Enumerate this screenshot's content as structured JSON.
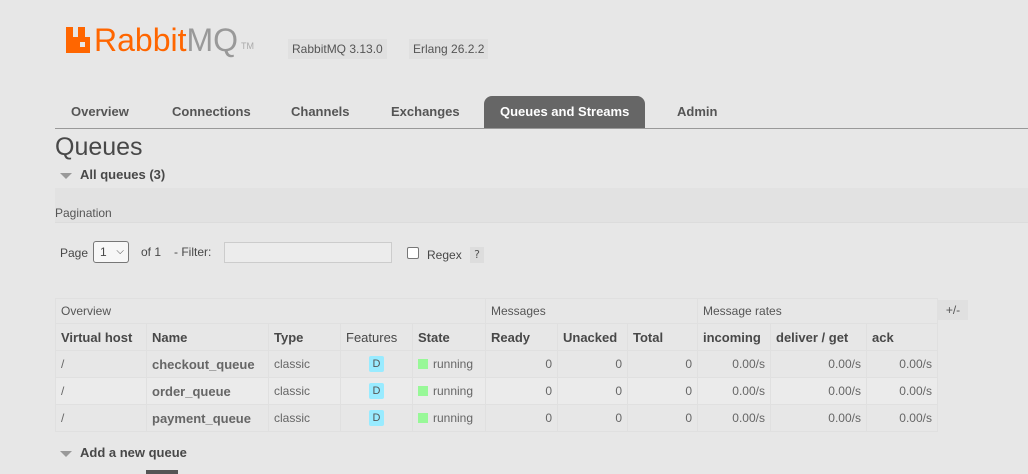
{
  "header": {
    "logo_rabbit": "Rabbit",
    "logo_mq": "MQ",
    "logo_tm": "TM",
    "version": "RabbitMQ 3.13.0",
    "erlang": "Erlang 26.2.2"
  },
  "tabs": [
    {
      "label": "Overview"
    },
    {
      "label": "Connections"
    },
    {
      "label": "Channels"
    },
    {
      "label": "Exchanges"
    },
    {
      "label": "Queues and Streams"
    },
    {
      "label": "Admin"
    }
  ],
  "active_tab": "Queues and Streams",
  "page_title": "Queues",
  "all_queues_label": "All queues (3)",
  "pagination": {
    "section_label": "Pagination",
    "page_label": "Page",
    "page_value": "1",
    "of_label": "of 1",
    "filter_label": "- Filter:",
    "filter_value": "",
    "regex_label": "Regex",
    "help_label": "?"
  },
  "table": {
    "groups": [
      "Overview",
      "Messages",
      "Message rates"
    ],
    "columns": [
      "Virtual host",
      "Name",
      "Type",
      "Features",
      "State",
      "Ready",
      "Unacked",
      "Total",
      "incoming",
      "deliver / get",
      "ack"
    ],
    "rows": [
      {
        "vhost": "/",
        "name": "checkout_queue",
        "type": "classic",
        "feature": "D",
        "state": "running",
        "ready": "0",
        "unacked": "0",
        "total": "0",
        "incoming": "0.00/s",
        "deliver": "0.00/s",
        "ack": "0.00/s"
      },
      {
        "vhost": "/",
        "name": "order_queue",
        "type": "classic",
        "feature": "D",
        "state": "running",
        "ready": "0",
        "unacked": "0",
        "total": "0",
        "incoming": "0.00/s",
        "deliver": "0.00/s",
        "ack": "0.00/s"
      },
      {
        "vhost": "/",
        "name": "payment_queue",
        "type": "classic",
        "feature": "D",
        "state": "running",
        "ready": "0",
        "unacked": "0",
        "total": "0",
        "incoming": "0.00/s",
        "deliver": "0.00/s",
        "ack": "0.00/s"
      }
    ],
    "plus_minus": "+/-"
  },
  "add_queue_label": "Add a new queue",
  "colors": {
    "brand": "#ff6600",
    "running": "#98f898",
    "durable_badge": "#99ebff",
    "active_tab": "#666666"
  }
}
